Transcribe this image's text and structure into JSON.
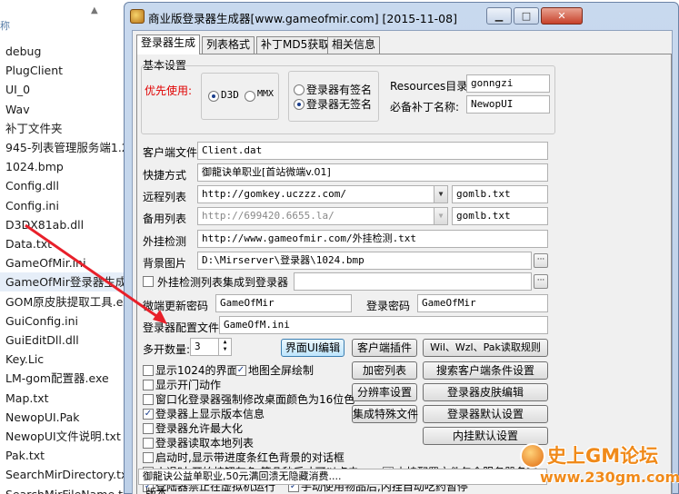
{
  "explorer": {
    "top_label": "称",
    "files": [
      "debug",
      "PlugClient",
      "UI_0",
      "Wav",
      "补丁文件夹",
      "945-列表管理服务端1.2",
      "1024.bmp",
      "Config.dll",
      "Config.ini",
      "D3DX81ab.dll",
      "Data.txt",
      "GameOfMir.ini",
      "GameOfMir登录器生成",
      "GOM原皮肤提取工具.ex",
      "GuiConfig.ini",
      "GuiEditDll.dll",
      "Key.Lic",
      "LM-gom配置器.exe",
      "Map.txt",
      "NewopUI.Pak",
      "NewopUI文件说明.txt",
      "Pak.txt",
      "SearchMirDirectory.txt",
      "SearchMirFileName.txt"
    ]
  },
  "window": {
    "title": "商业版登录器生成器[www.gameofmir.com] [2015-11-08]",
    "min_glyph": "▁",
    "max_glyph": "□",
    "close_glyph": "✕"
  },
  "tabs": [
    "登录器生成",
    "列表格式",
    "补丁MD5获取",
    "相关信息"
  ],
  "basic": {
    "group_label": "基本设置",
    "priority_label": "优先使用:",
    "d3d": "D3D",
    "mmx": "MMX",
    "signed": "登录器有签名",
    "unsigned": "登录器无签名",
    "resources_label": "Resources目录:",
    "resources_value": "gonngzi",
    "patch_label": "必备补丁名称:",
    "patch_value": "NewopUI"
  },
  "form": {
    "client_file_label": "客户端文件",
    "client_file_value": "Client.dat",
    "shortcut_label": "快捷方式",
    "shortcut_value": "御龍诀单职业[首站微端v.01]",
    "remote_list_label": "远程列表",
    "remote_list_value": "http://gomkey.uczzz.com/",
    "remote_list_file": "gomlb.txt",
    "backup_list_label": "备用列表",
    "backup_list_value": "http://699420.6655.la/",
    "backup_list_file": "gomlb.txt",
    "plugin_check_label": "外挂检测",
    "plugin_check_value": "http://www.gameofmir.com/外挂检测.txt",
    "bg_image_label": "背景图片",
    "bg_image_value": "D:\\Mirserver\\登录器\\1024.bmp",
    "plugin_integrate_label": "外挂检测列表集成到登录器",
    "wechat_pwd_label": "微端更新密码",
    "wechat_pwd_value": "GameOfMir",
    "login_pwd_label": "登录密码",
    "login_pwd_value": "GameOfMir",
    "config_file_label": "登录器配置文件",
    "config_file_value": "GameOfM.ini",
    "multi_open_label": "多开数量:",
    "multi_open_value": "3"
  },
  "buttons": {
    "ui_edit": "界面UI编辑",
    "client_plugin": "客户端插件",
    "wil_read": "Wil、Wzl、Pak读取规则",
    "encrypt_list": "加密列表",
    "search_client": "搜索客户端条件设置",
    "resolution": "分辨率设置",
    "skin_edit": "登录器皮肤编辑",
    "special_files": "集成特殊文件",
    "login_default": "登录器默认设置",
    "plugin_default": "内挂默认设置"
  },
  "options": [
    {
      "label": "显示1024的界面",
      "checked": false
    },
    {
      "label": "地图全屏绘制",
      "checked": true
    },
    {
      "label": "显示开门动作",
      "checked": false
    },
    {
      "label": "窗口化登录器强制修改桌面颜色为16位色",
      "checked": false
    },
    {
      "label": "登录器上显示版本信息",
      "checked": true
    },
    {
      "label": "登录器允许最大化",
      "checked": false
    },
    {
      "label": "登录器读取本地列表",
      "checked": false
    },
    {
      "label": "启动时,显示带进度条红色背景的对话框",
      "checked": false
    },
    {
      "label": "小退时,开始按钮灰色,等几秒后才可以点击",
      "checked": false
    },
    {
      "label": "内挂配置文件包含服务器名称",
      "checked": true
    },
    {
      "label": "登陆器禁止在虚拟机运行",
      "checked": true
    },
    {
      "label": "手动使用物品后,内挂自动吃药暂停",
      "checked": true
    }
  ],
  "notice": "御龍诀公益单职业,50元满回溃无隐藏消费....",
  "version_label": "版本",
  "watermark": {
    "title": "史上GM论坛",
    "url": "www.230gm.com"
  },
  "colors": {
    "priority_red": "#e00000",
    "watermark_orange": "#f08a1a",
    "arrow_red": "#e8202a"
  }
}
